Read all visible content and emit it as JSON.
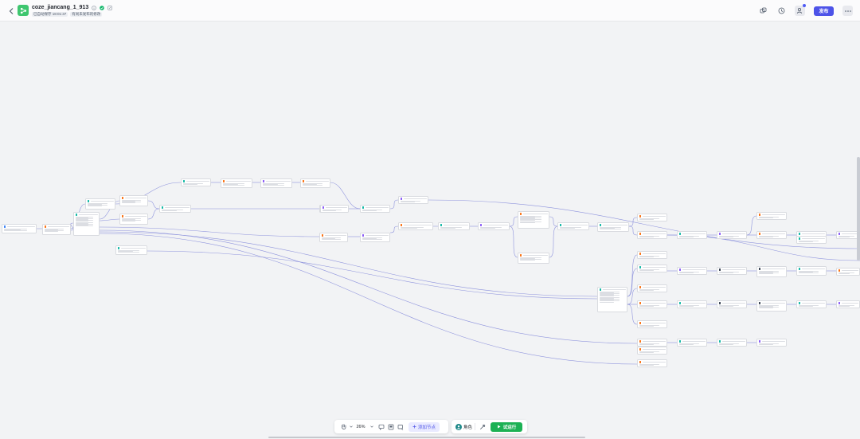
{
  "header": {
    "title": "coze_jiancang_1_913",
    "autosave_tag": "已自动保存 18:01:37",
    "publish_status_tag": "有尚未发布的修改",
    "publish_label": "发布",
    "colors": {
      "brand": "#4d53e8",
      "app_icon": "#3ec66f",
      "status_ok": "#12b76a"
    }
  },
  "toolbar": {
    "zoom": "26%",
    "add_node_label": "添加节点",
    "role_label": "角色",
    "run_label": "试运行",
    "colors": {
      "run": "#1cb154"
    }
  },
  "canvas": {
    "node_colors": {
      "start": "#3b82f6",
      "llm": "#f97316",
      "code": "#14b8a6",
      "plugin": "#8b5cf6",
      "dark": "#374151",
      "end": "#ef4444"
    },
    "nodes": [
      {
        "id": "n1",
        "kind": "start"
      },
      {
        "id": "n2",
        "kind": "llm"
      },
      {
        "id": "n3",
        "kind": "code"
      },
      {
        "id": "n4",
        "kind": "code"
      },
      {
        "id": "n5",
        "kind": "llm"
      },
      {
        "id": "n6",
        "kind": "llm"
      },
      {
        "id": "n7",
        "kind": "code"
      },
      {
        "id": "n8",
        "kind": "code"
      },
      {
        "id": "n9",
        "kind": "code"
      },
      {
        "id": "n10",
        "kind": "llm"
      },
      {
        "id": "n11",
        "kind": "plugin"
      },
      {
        "id": "n12",
        "kind": "llm"
      },
      {
        "id": "n13",
        "kind": "plugin"
      },
      {
        "id": "n14",
        "kind": "code"
      },
      {
        "id": "n15",
        "kind": "plugin"
      },
      {
        "id": "n16",
        "kind": "llm"
      },
      {
        "id": "n17",
        "kind": "plugin"
      },
      {
        "id": "n18",
        "kind": "llm"
      },
      {
        "id": "n19",
        "kind": "code"
      },
      {
        "id": "n20",
        "kind": "plugin"
      },
      {
        "id": "n21",
        "kind": "llm"
      },
      {
        "id": "n22",
        "kind": "llm"
      },
      {
        "id": "n23",
        "kind": "code"
      },
      {
        "id": "n24",
        "kind": "code"
      },
      {
        "id": "n25",
        "kind": "llm"
      },
      {
        "id": "n26",
        "kind": "llm"
      },
      {
        "id": "n27",
        "kind": "code"
      },
      {
        "id": "n28",
        "kind": "plugin"
      },
      {
        "id": "n29",
        "kind": "llm"
      },
      {
        "id": "n30",
        "kind": "llm"
      },
      {
        "id": "n31",
        "kind": "code"
      },
      {
        "id": "n32",
        "kind": "plugin"
      },
      {
        "id": "n33",
        "kind": "llm"
      },
      {
        "id": "n34",
        "kind": "code"
      },
      {
        "id": "n35",
        "kind": "plugin"
      },
      {
        "id": "n36",
        "kind": "code"
      },
      {
        "id": "n37",
        "kind": "llm"
      },
      {
        "id": "n38",
        "kind": "llm"
      },
      {
        "id": "n39",
        "kind": "llm"
      },
      {
        "id": "n40",
        "kind": "llm"
      },
      {
        "id": "n41",
        "kind": "llm"
      },
      {
        "id": "n42",
        "kind": "llm"
      },
      {
        "id": "n43",
        "kind": "code"
      },
      {
        "id": "n44",
        "kind": "code"
      },
      {
        "id": "n45",
        "kind": "code"
      },
      {
        "id": "n46",
        "kind": "dark"
      },
      {
        "id": "n47",
        "kind": "dark"
      },
      {
        "id": "n48",
        "kind": "plugin"
      },
      {
        "id": "n49",
        "kind": "dark"
      },
      {
        "id": "n50",
        "kind": "dark"
      },
      {
        "id": "n51",
        "kind": "code"
      },
      {
        "id": "n52",
        "kind": "code"
      },
      {
        "id": "n53",
        "kind": "llm"
      },
      {
        "id": "n54",
        "kind": "plugin"
      },
      {
        "id": "n55",
        "kind": "code"
      },
      {
        "id": "n56",
        "kind": "plugin"
      },
      {
        "id": "n57",
        "kind": "plugin"
      },
      {
        "id": "n58",
        "kind": "llm"
      },
      {
        "id": "n59",
        "kind": "code"
      },
      {
        "id": "n60",
        "kind": "code"
      }
    ]
  }
}
